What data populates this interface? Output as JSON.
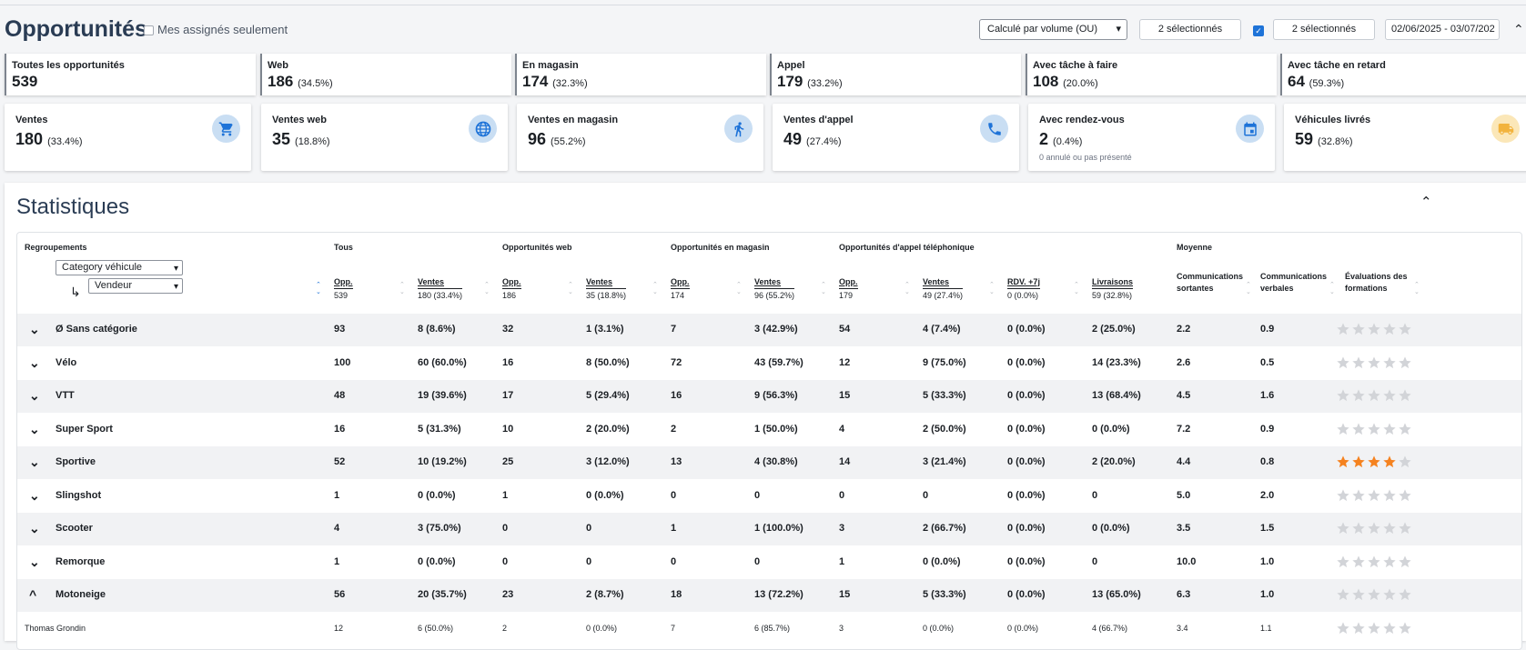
{
  "header": {
    "title": "Opportunités",
    "mine_label": "Mes assignés seulement",
    "calc_select": "Calculé par volume (OU)",
    "selection1": "2 sélectionnés",
    "selection2": "2 sélectionnés",
    "date_range": "02/06/2025 - 03/07/202"
  },
  "summary": [
    {
      "label": "Toutes les opportunités",
      "value": "539",
      "pct": ""
    },
    {
      "label": "Web",
      "value": "186",
      "pct": "(34.5%)"
    },
    {
      "label": "En magasin",
      "value": "174",
      "pct": "(32.3%)"
    },
    {
      "label": "Appel",
      "value": "179",
      "pct": "(33.2%)"
    },
    {
      "label": "Avec tâche à faire",
      "value": "108",
      "pct": "(20.0%)"
    },
    {
      "label": "Avec tâche en retard",
      "value": "64",
      "pct": "(59.3%)"
    }
  ],
  "metrics": [
    {
      "label": "Ventes",
      "value": "180",
      "pct": "(33.4%)",
      "icon": "cart-icon",
      "note": ""
    },
    {
      "label": "Ventes web",
      "value": "35",
      "pct": "(18.8%)",
      "icon": "globe-icon",
      "note": ""
    },
    {
      "label": "Ventes en magasin",
      "value": "96",
      "pct": "(55.2%)",
      "icon": "walking-person-icon",
      "note": ""
    },
    {
      "label": "Ventes d'appel",
      "value": "49",
      "pct": "(27.4%)",
      "icon": "phone-icon",
      "note": ""
    },
    {
      "label": "Avec rendez-vous",
      "value": "2",
      "pct": "(0.4%)",
      "icon": "calendar-icon",
      "note": "0 annulé ou pas présenté"
    },
    {
      "label": "Véhicules livrés",
      "value": "59",
      "pct": "(32.8%)",
      "icon": "truck-icon",
      "note": ""
    }
  ],
  "stats": {
    "title": "Statistiques",
    "groups": {
      "regroupements": "Regroupements",
      "tous": "Tous",
      "web": "Opportunités web",
      "magasin": "Opportunités en magasin",
      "appel": "Opportunités d'appel téléphonique",
      "moyenne": "Moyenne"
    },
    "grouping_dd1": "Category véhicule",
    "grouping_dd2": "Vendeur",
    "columns": [
      {
        "label": "Opp.",
        "sub": "539"
      },
      {
        "label": "Ventes",
        "sub": "180 (33.4%)"
      },
      {
        "label": "Opp.",
        "sub": "186"
      },
      {
        "label": "Ventes",
        "sub": "35 (18.8%)"
      },
      {
        "label": "Opp.",
        "sub": "174"
      },
      {
        "label": "Ventes",
        "sub": "96 (55.2%)"
      },
      {
        "label": "Opp.",
        "sub": "179"
      },
      {
        "label": "Ventes",
        "sub": "49 (27.4%)"
      },
      {
        "label": "RDV. +7j",
        "sub": "0 (0.0%)"
      },
      {
        "label": "Livraisons",
        "sub": "59 (32.8%)"
      }
    ],
    "avg_columns": [
      "Communications sortantes",
      "Communications verbales",
      "Évaluations des formations"
    ],
    "rows": [
      {
        "name": "Ø Sans catégorie",
        "toggle": "⌄",
        "cells": [
          "93",
          "8 (8.6%)",
          "32",
          "1 (3.1%)",
          "7",
          "3 (42.9%)",
          "54",
          "4 (7.4%)",
          "0 (0.0%)",
          "2 (25.0%)",
          "2.2",
          "0.9"
        ],
        "rating": 0
      },
      {
        "name": "Vélo",
        "toggle": "⌄",
        "cells": [
          "100",
          "60 (60.0%)",
          "16",
          "8 (50.0%)",
          "72",
          "43 (59.7%)",
          "12",
          "9 (75.0%)",
          "0 (0.0%)",
          "14 (23.3%)",
          "2.6",
          "0.5"
        ],
        "rating": 0
      },
      {
        "name": "VTT",
        "toggle": "⌄",
        "cells": [
          "48",
          "19 (39.6%)",
          "17",
          "5 (29.4%)",
          "16",
          "9 (56.3%)",
          "15",
          "5 (33.3%)",
          "0 (0.0%)",
          "13 (68.4%)",
          "4.5",
          "1.6"
        ],
        "rating": 0
      },
      {
        "name": "Super Sport",
        "toggle": "⌄",
        "cells": [
          "16",
          "5 (31.3%)",
          "10",
          "2 (20.0%)",
          "2",
          "1 (50.0%)",
          "4",
          "2 (50.0%)",
          "0 (0.0%)",
          "0 (0.0%)",
          "7.2",
          "0.9"
        ],
        "rating": 0
      },
      {
        "name": "Sportive",
        "toggle": "⌄",
        "cells": [
          "52",
          "10 (19.2%)",
          "25",
          "3 (12.0%)",
          "13",
          "4 (30.8%)",
          "14",
          "3 (21.4%)",
          "0 (0.0%)",
          "2 (20.0%)",
          "4.4",
          "0.8"
        ],
        "rating": 4
      },
      {
        "name": "Slingshot",
        "toggle": "⌄",
        "cells": [
          "1",
          "0 (0.0%)",
          "1",
          "0 (0.0%)",
          "0",
          "0",
          "0",
          "0",
          "0 (0.0%)",
          "0",
          "5.0",
          "2.0"
        ],
        "rating": 0
      },
      {
        "name": "Scooter",
        "toggle": "⌄",
        "cells": [
          "4",
          "3 (75.0%)",
          "0",
          "0",
          "1",
          "1 (100.0%)",
          "3",
          "2 (66.7%)",
          "0 (0.0%)",
          "0 (0.0%)",
          "3.5",
          "1.5"
        ],
        "rating": 0
      },
      {
        "name": "Remorque",
        "toggle": "⌄",
        "cells": [
          "1",
          "0 (0.0%)",
          "0",
          "0",
          "0",
          "0",
          "1",
          "0 (0.0%)",
          "0 (0.0%)",
          "0",
          "10.0",
          "1.0"
        ],
        "rating": 0
      },
      {
        "name": "Motoneige",
        "toggle": "^",
        "cells": [
          "56",
          "20 (35.7%)",
          "23",
          "2 (8.7%)",
          "18",
          "13 (72.2%)",
          "15",
          "5 (33.3%)",
          "0 (0.0%)",
          "13 (65.0%)",
          "6.3",
          "1.0"
        ],
        "rating": 0
      }
    ],
    "subrows": [
      {
        "name": "Thomas Grondin",
        "cells": [
          "12",
          "6 (50.0%)",
          "2",
          "0 (0.0%)",
          "7",
          "6 (85.7%)",
          "3",
          "0 (0.0%)",
          "0 (0.0%)",
          "4 (66.7%)",
          "3.4",
          "1.1"
        ],
        "rating": 0
      }
    ]
  },
  "colors": {
    "accent": "#1e73d8",
    "icon_bg": "#c9def3",
    "icon_fg": "#1e73d8",
    "truck_bg": "#fbe7b8",
    "truck_fg": "#f2b33d",
    "star_on": "#f5821f",
    "star_off": "#d2d4d8",
    "title": "#2a3c54"
  }
}
